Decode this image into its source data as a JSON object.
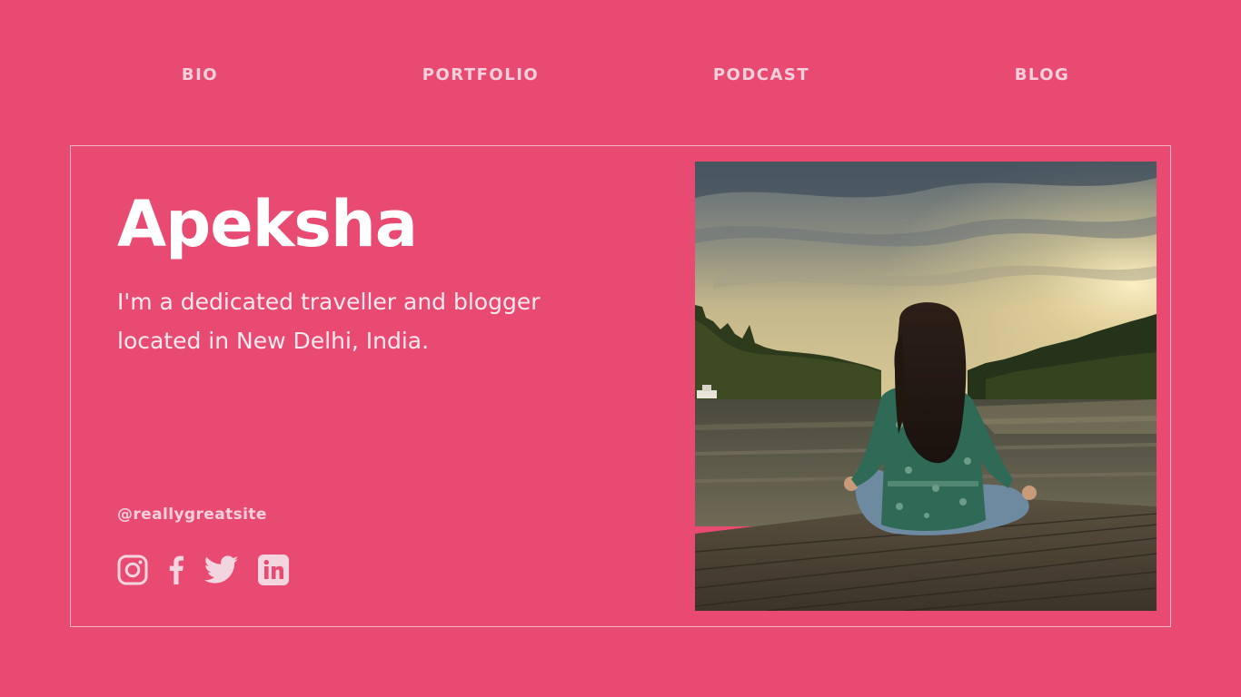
{
  "nav": {
    "items": [
      {
        "label": "BIO"
      },
      {
        "label": "PORTFOLIO"
      },
      {
        "label": "PODCAST"
      },
      {
        "label": "BLOG"
      }
    ]
  },
  "profile": {
    "name": "Apeksha",
    "tagline_line1": "I'm a dedicated traveller and blogger",
    "tagline_line2": "located in New Delhi, India.",
    "handle": "@reallygreatsite"
  },
  "socials": {
    "icons": [
      "instagram-icon",
      "facebook-icon",
      "twitter-icon",
      "linkedin-icon"
    ]
  },
  "photo": {
    "subject": "woman meditating cross-legged on a wooden pier by a lake at sunset"
  },
  "colors": {
    "background": "#e94a72",
    "nav_text": "#f6d0dc",
    "heading": "#ffffff",
    "border": "#f4b5c6",
    "icons": "#f2d5de"
  }
}
